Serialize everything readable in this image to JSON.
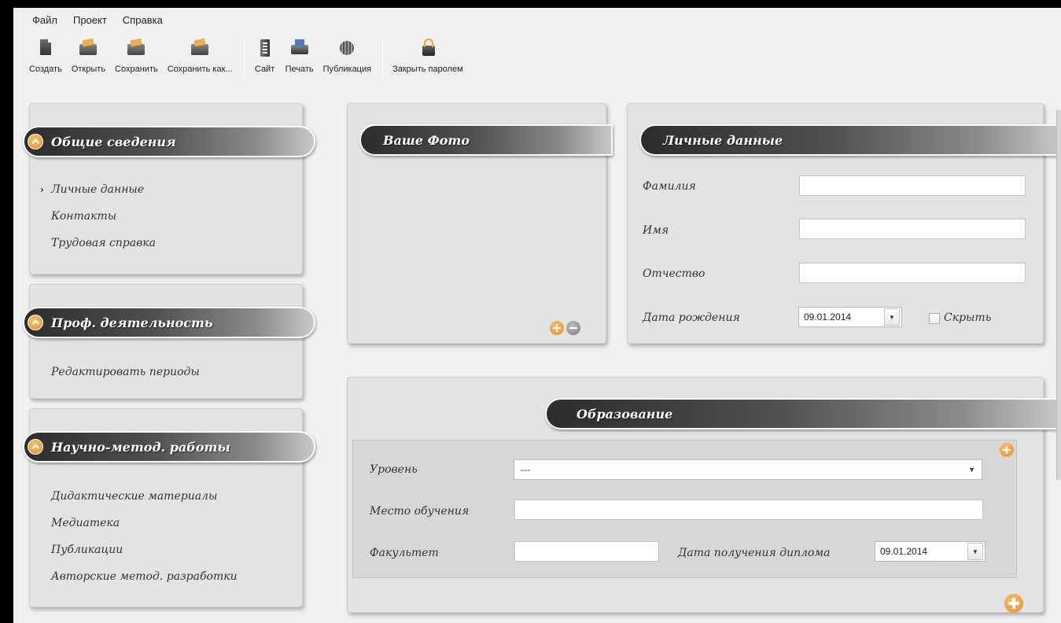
{
  "menu": [
    "Файл",
    "Проект",
    "Справка"
  ],
  "toolbar": {
    "create": "Создать",
    "open": "Открыть",
    "save": "Сохранить",
    "save_as": "Сохранить как...",
    "site": "Сайт",
    "print": "Печать",
    "publish": "Публикация",
    "lock": "Закрыть паролем"
  },
  "sidebar": {
    "general": {
      "title": "Общие сведения",
      "items": [
        "Личные данные",
        "Контакты",
        "Трудовая справка"
      ],
      "active_marker": "›"
    },
    "prof": {
      "title": "Проф. деятельность",
      "items": [
        "Редактировать периоды"
      ]
    },
    "sci": {
      "title": "Научно-метод. работы",
      "items": [
        "Дидактические материалы",
        "Медиатека",
        "Публикации",
        "Авторские метод. разработки"
      ]
    }
  },
  "photo": {
    "title": "Ваше Фото"
  },
  "personal": {
    "title": "Личные данные",
    "last_name_label": "Фамилия",
    "last_name_value": "",
    "first_name_label": "Имя",
    "first_name_value": "",
    "patronymic_label": "Отчество",
    "patronymic_value": "",
    "birth_label": "Дата рождения",
    "birth_value": "09.01.2014",
    "hide_label": "Скрыть",
    "hide_checked": false
  },
  "education": {
    "title": "Образование",
    "level_label": "Уровень",
    "level_value": "---",
    "place_label": "Место обучения",
    "place_value": "",
    "faculty_label": "Факультет",
    "faculty_value": "",
    "diploma_label": "Дата получения диплома",
    "diploma_value": "09.01.2014"
  },
  "colors": {
    "accent": "#e8a23c",
    "ribbon_dark": "#2c2c2c",
    "panel_bg": "#e3e3e3"
  }
}
